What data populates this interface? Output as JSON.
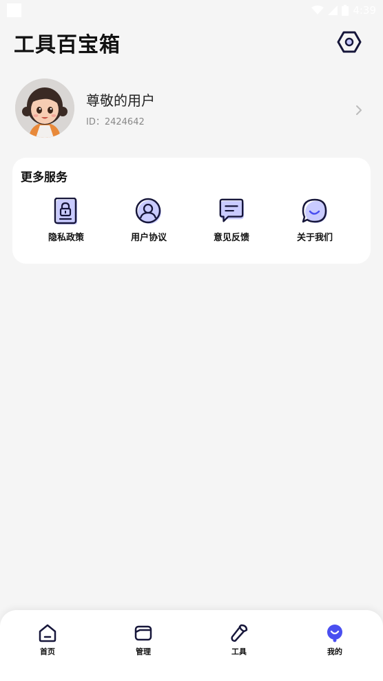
{
  "status_bar": {
    "time": "4:39"
  },
  "header": {
    "title": "工具百宝箱"
  },
  "profile": {
    "name": "尊敬的用户",
    "id_text": "ID：2424642"
  },
  "services": {
    "title": "更多服务",
    "items": [
      {
        "label": "隐私政策",
        "icon": "privacy-lock-icon"
      },
      {
        "label": "用户协议",
        "icon": "user-agreement-icon"
      },
      {
        "label": "意见反馈",
        "icon": "feedback-message-icon"
      },
      {
        "label": "关于我们",
        "icon": "about-chat-icon"
      }
    ]
  },
  "tab_bar": {
    "tabs": [
      {
        "label": "首页",
        "icon": "home-icon",
        "active": false
      },
      {
        "label": "管理",
        "icon": "folder-icon",
        "active": false
      },
      {
        "label": "工具",
        "icon": "wrench-icon",
        "active": false
      },
      {
        "label": "我的",
        "icon": "profile-icon",
        "active": true
      }
    ]
  },
  "colors": {
    "accent": "#4a4ff0",
    "icon_dark": "#16163a",
    "background": "#f5f5f5"
  }
}
